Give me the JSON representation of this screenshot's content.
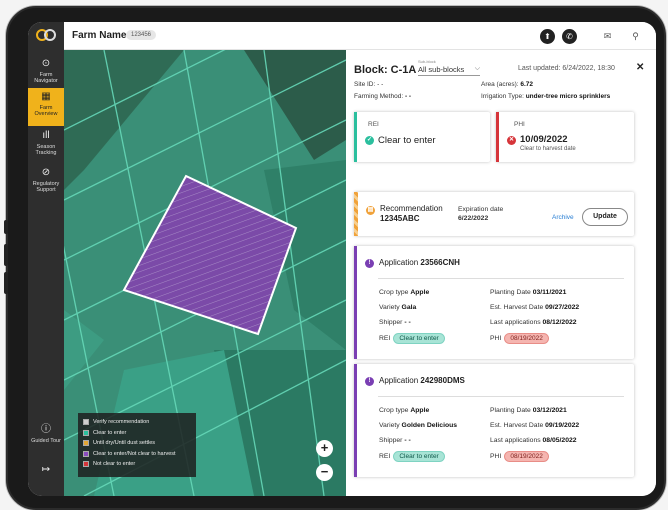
{
  "header": {
    "farm_name": "Farm Name",
    "farm_id": "123456"
  },
  "sidebar": {
    "items": [
      {
        "label": "Farm Navigator",
        "icon": "compass-icon",
        "active": false
      },
      {
        "label": "Farm Overview",
        "icon": "grid-icon",
        "active": true
      },
      {
        "label": "Season Tracking",
        "icon": "bar-chart-icon",
        "active": false
      },
      {
        "label": "Regulatory Support",
        "icon": "check-circle-icon",
        "active": false
      }
    ],
    "bottom": [
      {
        "label": "Guided Tour",
        "icon": "info-icon"
      },
      {
        "label": "",
        "icon": "logout-icon"
      }
    ]
  },
  "legend": [
    {
      "label": "Verify recommendation",
      "color": "#cfcfcf"
    },
    {
      "label": "Clear to enter",
      "color": "#2bbf9e"
    },
    {
      "label": "Until dry/Until dust settles",
      "color": "#e2a634"
    },
    {
      "label": "Clear to enter/Not clear to harvest",
      "color": "#8a4dbe"
    },
    {
      "label": "Not clear to enter",
      "color": "#d6353a"
    }
  ],
  "panel": {
    "block_label": "Block: C-1A",
    "subblock_label": "Sub-block",
    "subblock_value": "All sub-blocks",
    "last_updated": "Last updated: 6/24/2022, 18:30",
    "site_id_label": "Site ID:",
    "site_id_value": "- -",
    "area_label": "Area (acres):",
    "area_value": "6.72",
    "farming_method_label": "Farming Method:",
    "farming_method_value": "- -",
    "irrigation_label": "Irrigation Type:",
    "irrigation_value": "under-tree micro sprinklers",
    "rei_title": "REI",
    "rei_value": "Clear to enter",
    "phi_title": "PHI",
    "phi_date": "10/09/2022",
    "phi_sub": "Clear to harvest date",
    "recommendation_title": "Recommendation",
    "recommendation_id": "12345ABC",
    "expiration_label": "Expiration date",
    "expiration_value": "6/22/2022",
    "archive_label": "Archive",
    "update_label": "Update",
    "applications": [
      {
        "title": "Application",
        "id": "23566CNH",
        "crop_label": "Crop type",
        "crop": "Apple",
        "variety_label": "Variety",
        "variety": "Gala",
        "shipper_label": "Shipper",
        "shipper": "- -",
        "rei_label": "REI",
        "rei": "Clear to enter",
        "planting_label": "Planting Date",
        "planting": "03/11/2021",
        "harvest_label": "Est. Harvest Date",
        "harvest": "09/27/2022",
        "last_app_label": "Last applications",
        "last_app": "08/12/2022",
        "phi_label": "PHI",
        "phi": "08/19/2022"
      },
      {
        "title": "Application",
        "id": "242980DMS",
        "crop_label": "Crop type",
        "crop": "Apple",
        "variety_label": "Variety",
        "variety": "Golden Delicious",
        "shipper_label": "Shipper",
        "shipper": "- -",
        "rei_label": "REI",
        "rei": "Clear to enter",
        "planting_label": "Planting Date",
        "planting": "03/12/2021",
        "harvest_label": "Est. Harvest Date",
        "harvest": "09/19/2022",
        "last_app_label": "Last applications",
        "last_app": "08/05/2022",
        "phi_label": "PHI",
        "phi": "08/19/2022"
      }
    ]
  },
  "colors": {
    "accent": "#f0b21b",
    "green": "#2bbf9e",
    "red": "#d6353a",
    "purple": "#7a3fb3",
    "orange": "#f0a23a"
  }
}
